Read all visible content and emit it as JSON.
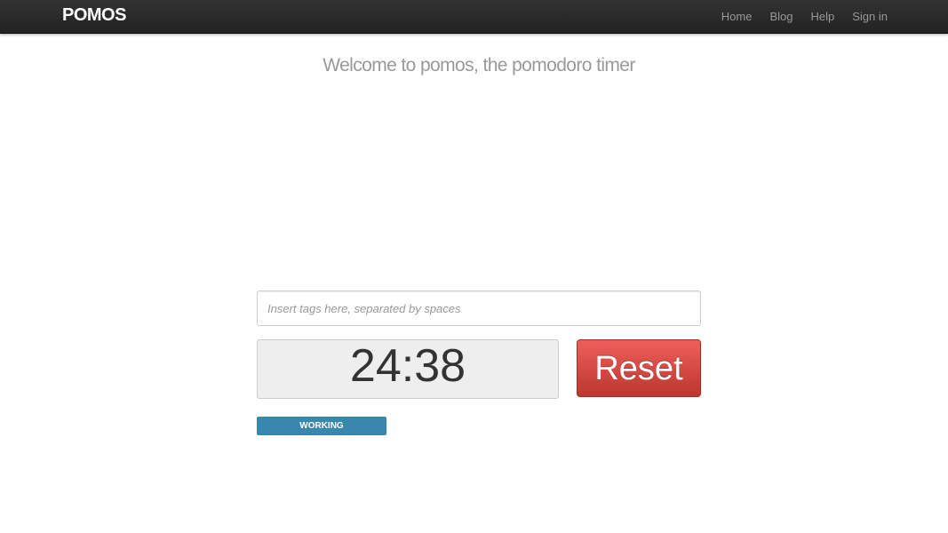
{
  "navbar": {
    "brand": "POMOS",
    "links": [
      {
        "label": "Home"
      },
      {
        "label": "Blog"
      },
      {
        "label": "Help"
      },
      {
        "label": "Sign in"
      }
    ]
  },
  "main": {
    "welcome": "Welcome to pomos, the pomodoro timer",
    "tags_input": {
      "value": "",
      "placeholder": "Insert tags here, separated by spaces"
    },
    "timer": "24:38",
    "reset_label": "Reset",
    "status": "WORKING"
  },
  "colors": {
    "navbar_bg": "#222222",
    "reset_button": "#da4f49",
    "status_badge": "#3a87ad",
    "timer_bg": "#eeeeee"
  }
}
